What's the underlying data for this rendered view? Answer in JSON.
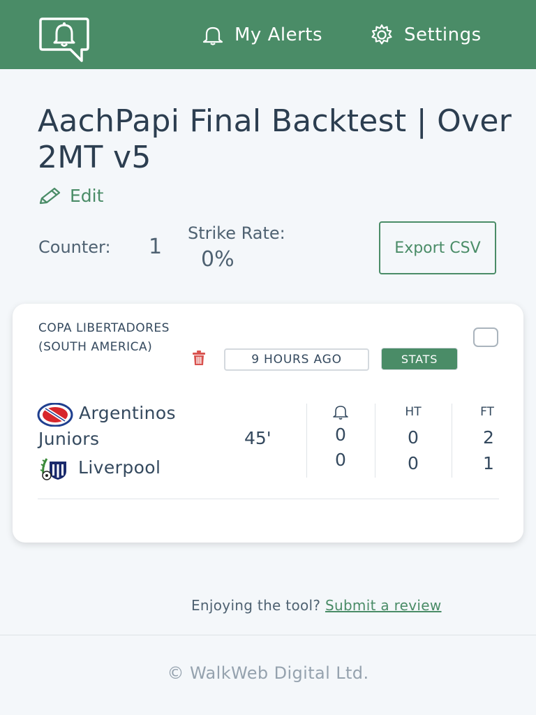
{
  "nav": {
    "alerts_label": "My Alerts",
    "settings_label": "Settings"
  },
  "page": {
    "title": "AachPapi Final Backtest | Over 2MT v5",
    "edit_label": "Edit",
    "counter_label": "Counter:",
    "counter_value": "1",
    "strike_rate_label": "Strike Rate:",
    "strike_rate_value": "0%",
    "export_label": "Export CSV"
  },
  "match": {
    "league": "COPA LIBERTADORES (SOUTH AMERICA)",
    "time_ago": "9 HOURS AGO",
    "stats_label": "STATS",
    "home_team": "Argentinos Juniors",
    "away_team": "Liverpool",
    "minute": "45'",
    "ht_label": "HT",
    "ft_label": "FT",
    "alert_home": "0",
    "alert_away": "0",
    "ht_home": "0",
    "ht_away": "0",
    "ft_home": "2",
    "ft_away": "1"
  },
  "footer": {
    "review_prompt": "Enjoying the tool?",
    "review_link": "Submit a review",
    "copyright": "© WalkWeb Digital Ltd."
  },
  "icons": {
    "logo": "bell-chat-icon",
    "alerts": "bell-icon",
    "settings": "gear-icon",
    "edit": "pencil-icon",
    "delete": "trash-icon",
    "alert_column": "bell-icon"
  },
  "colors": {
    "brand_green": "#4a8c67",
    "background": "#f4f7fa",
    "text": "#34495e",
    "danger": "#d9534f"
  }
}
